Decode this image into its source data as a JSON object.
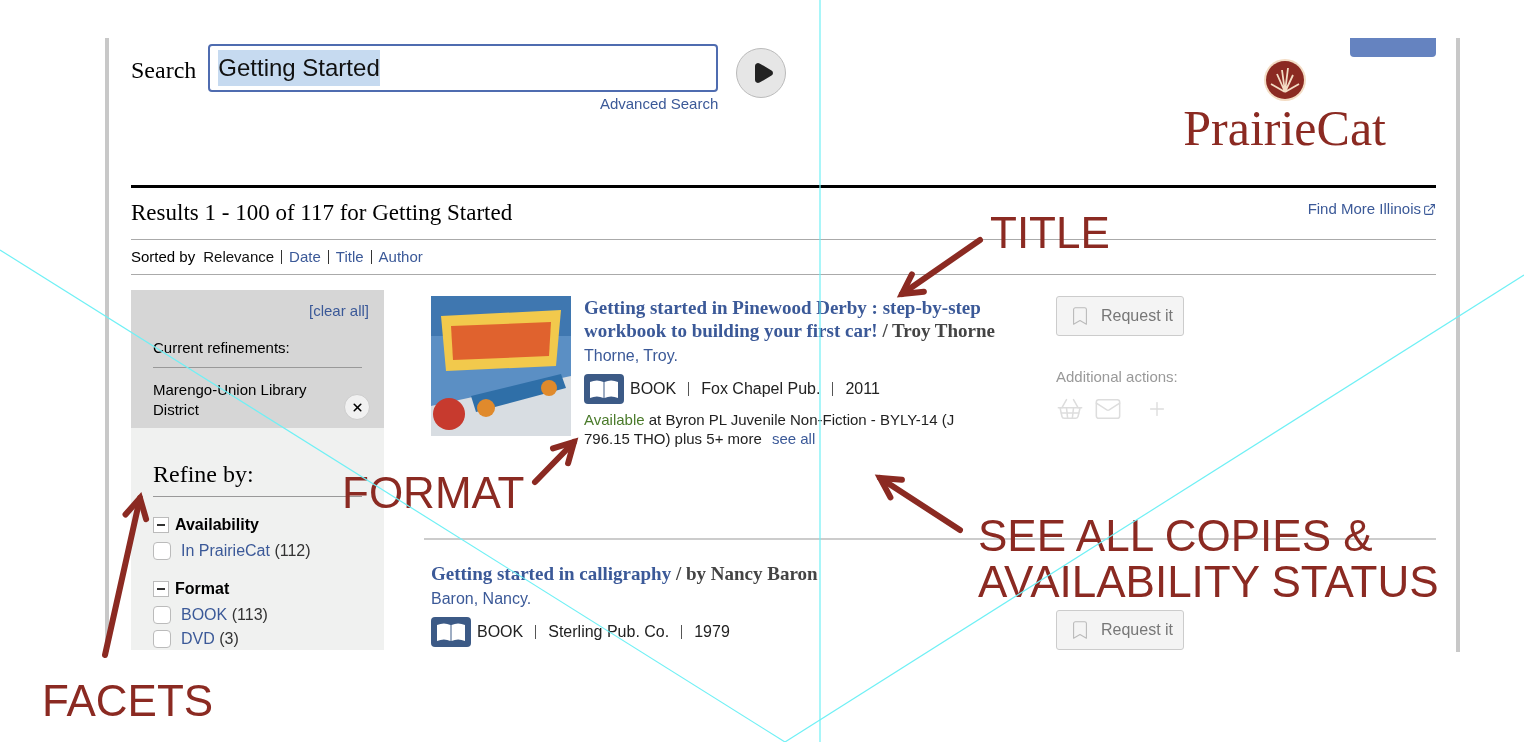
{
  "search": {
    "label": "Search",
    "value": "Getting Started",
    "advanced_link": "Advanced Search"
  },
  "logo": {
    "text": "PrairieCat"
  },
  "results_heading": "Results 1 - 100 of 117 for Getting Started",
  "find_more_link": "Find More Illinois",
  "sort": {
    "label": "Sorted by",
    "options": [
      {
        "label": "Relevance",
        "selected": true
      },
      {
        "label": "Date",
        "selected": false
      },
      {
        "label": "Title",
        "selected": false
      },
      {
        "label": "Author",
        "selected": false
      }
    ]
  },
  "refinements": {
    "clear_all": "[clear all]",
    "label": "Current refinements:",
    "items": [
      "Marengo-Union Library District"
    ]
  },
  "refine_by": {
    "title": "Refine by:",
    "groups": [
      {
        "title": "Availability",
        "expanded": true,
        "options": [
          {
            "label": "In PrairieCat",
            "count": "(112)",
            "checked": false
          }
        ]
      },
      {
        "title": "Format",
        "expanded": true,
        "options": [
          {
            "label": "BOOK",
            "count": "(113)",
            "checked": false
          },
          {
            "label": "DVD",
            "count": "(3)",
            "checked": false
          }
        ]
      }
    ]
  },
  "results": [
    {
      "title": "Getting started in Pinewood Derby : step-by-step workbook to building your first car!",
      "statement": "/ Troy Thorne",
      "author": "Thorne, Troy.",
      "format": "BOOK",
      "publisher": "Fox Chapel Pub.",
      "year": "2011",
      "availability": {
        "status": "Available",
        "text": "at Byron PL Juvenile Non-Fiction - BYLY-14 (J 796.15 THO) plus 5+ more",
        "link": "see all"
      },
      "request": "Request it",
      "actions_label": "Additional actions:",
      "cover": true
    },
    {
      "title": "Getting started in calligraphy",
      "statement": "/ by Nancy Baron",
      "author": "Baron, Nancy.",
      "format": "BOOK",
      "publisher": "Sterling Pub. Co.",
      "year": "1979",
      "request": "Request it",
      "cover": false
    }
  ],
  "annotations": [
    {
      "kind": "title",
      "text": "TITLE"
    },
    {
      "kind": "format",
      "text": "FORMAT"
    },
    {
      "kind": "copies",
      "text": "SEE ALL COPIES & AVAILABILITY STATUS"
    },
    {
      "kind": "facets",
      "text": "FACETS"
    }
  ]
}
